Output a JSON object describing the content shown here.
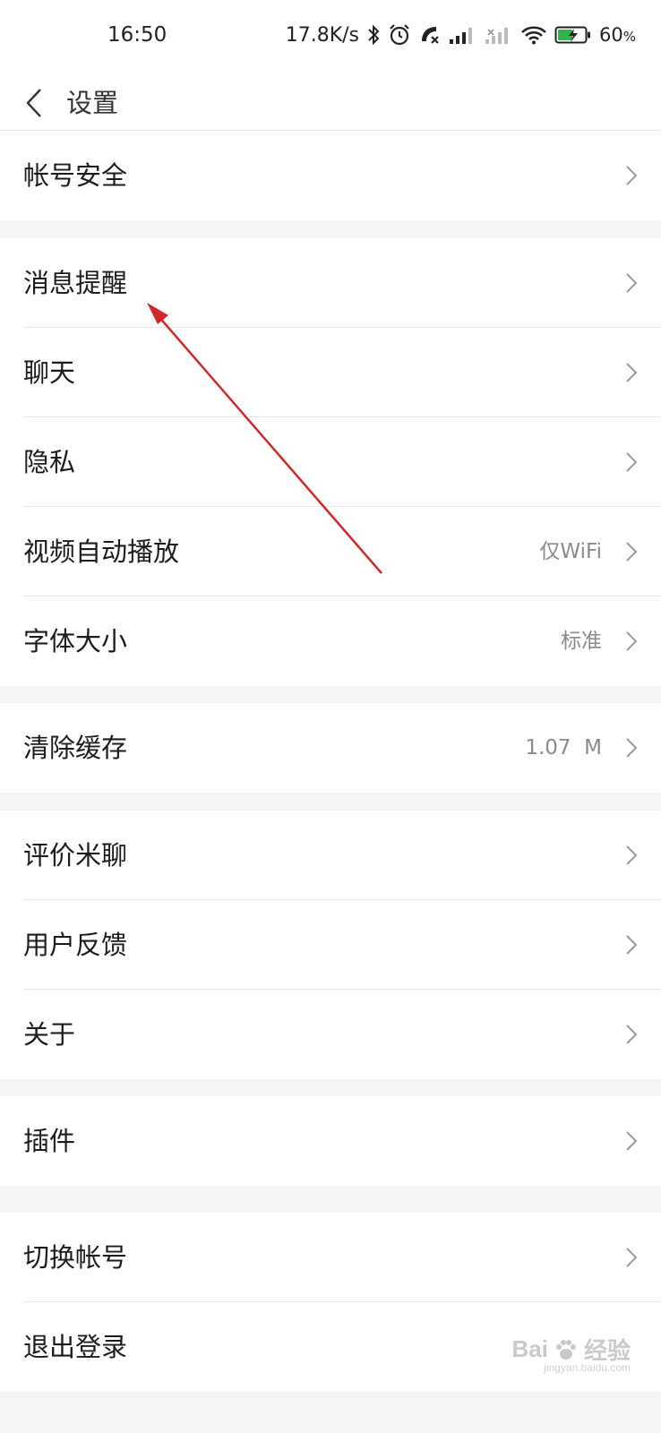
{
  "status_bar": {
    "time": "16:50",
    "network_speed": "17.8K/s",
    "battery_percent": "60",
    "battery_unit": "%",
    "icons": [
      "bluetooth-icon",
      "alarm-icon",
      "missed-call-icon",
      "signal-icon",
      "signal-off-icon",
      "wifi-icon",
      "battery-charging-icon"
    ]
  },
  "header": {
    "title": "设置",
    "back_icon": "chevron-left-icon"
  },
  "groups": [
    {
      "items": [
        {
          "label": "帐号安全",
          "value": ""
        }
      ]
    },
    {
      "items": [
        {
          "label": "消息提醒",
          "value": ""
        },
        {
          "label": "聊天",
          "value": ""
        },
        {
          "label": "隐私",
          "value": ""
        },
        {
          "label": "视频自动播放",
          "value": "仅WiFi"
        },
        {
          "label": "字体大小",
          "value": "标准"
        }
      ]
    },
    {
      "items": [
        {
          "label": "清除缓存",
          "value": "1.07  M"
        }
      ]
    },
    {
      "items": [
        {
          "label": "评价米聊",
          "value": ""
        },
        {
          "label": "用户反馈",
          "value": ""
        },
        {
          "label": "关于",
          "value": ""
        }
      ]
    },
    {
      "items": [
        {
          "label": "插件",
          "value": ""
        }
      ]
    },
    {
      "items": [
        {
          "label": "切换帐号",
          "value": ""
        },
        {
          "label": "退出登录",
          "value": ""
        }
      ]
    }
  ],
  "annotation": {
    "color": "#d0282a",
    "points_to": "消息提醒"
  },
  "watermark": {
    "brand": "Bai",
    "brand2": "经验",
    "url": "jingyan.baidu.com"
  },
  "colors": {
    "background": "#f4f4f4",
    "surface": "#ffffff",
    "value_text": "#8a8a8a",
    "chevron": "#9a9a9a"
  }
}
